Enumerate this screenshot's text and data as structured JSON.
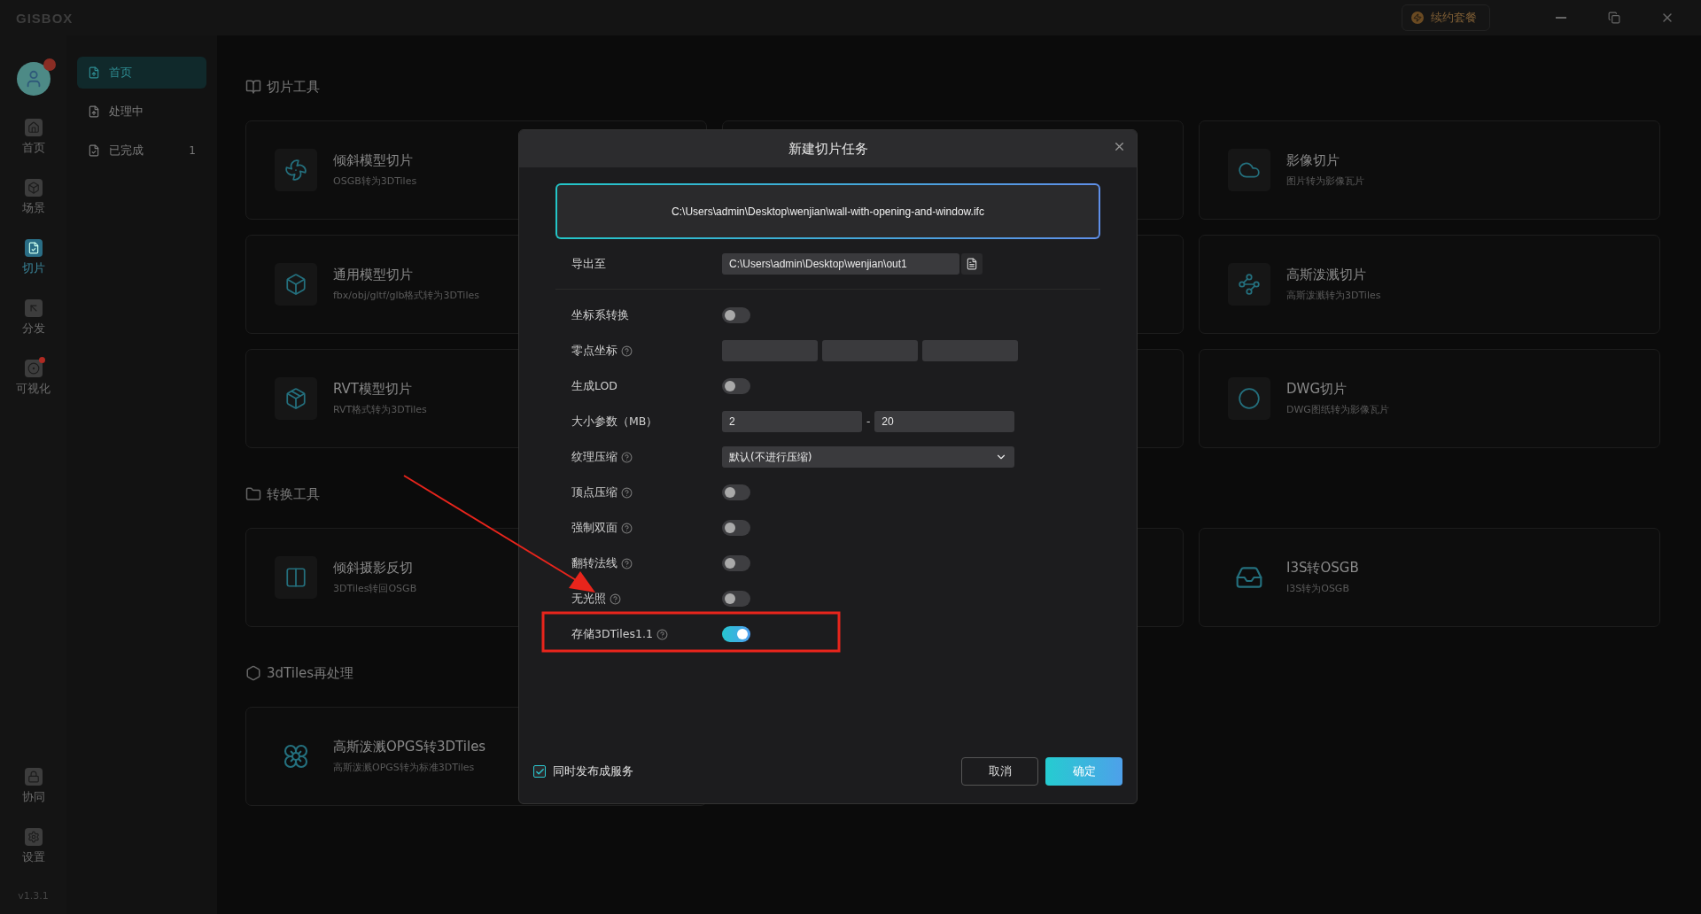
{
  "app": {
    "logo": "GISBOX",
    "renew": "续约套餐",
    "version": "v1.3.1"
  },
  "rail": [
    {
      "label": "首页",
      "selected": false,
      "dot": false
    },
    {
      "label": "场景",
      "selected": false,
      "dot": false
    },
    {
      "label": "切片",
      "selected": true,
      "dot": false
    },
    {
      "label": "分发",
      "selected": false,
      "dot": false
    },
    {
      "label": "可视化",
      "selected": false,
      "dot": true
    }
  ],
  "rail_bottom": [
    {
      "label": "协同"
    },
    {
      "label": "设置"
    }
  ],
  "subnav": [
    {
      "label": "首页",
      "selected": true
    },
    {
      "label": "处理中",
      "selected": false
    },
    {
      "label": "已完成",
      "selected": false,
      "count": "1"
    }
  ],
  "sections": [
    {
      "title": "切片工具",
      "rows": [
        [
          {
            "kind": "card",
            "title": "倾斜模型切片",
            "subtitle": "OSGB转为3DTiles"
          },
          {
            "kind": "covered"
          },
          {
            "kind": "card",
            "title": "影像切片",
            "subtitle": "图片转为影像瓦片"
          }
        ],
        [
          {
            "kind": "card",
            "title": "通用模型切片",
            "subtitle": "fbx/obj/gltf/glb格式转为3DTiles"
          },
          {
            "kind": "covered"
          },
          {
            "kind": "card",
            "title": "高斯泼溅切片",
            "subtitle": "高斯泼溅转为3DTiles"
          }
        ],
        [
          {
            "kind": "card",
            "title": "RVT模型切片",
            "subtitle": "RVT格式转为3DTiles"
          },
          {
            "kind": "covered"
          },
          {
            "kind": "card",
            "title": "DWG切片",
            "subtitle": "DWG图纸转为影像瓦片"
          }
        ]
      ]
    },
    {
      "title": "转换工具",
      "rows": [
        [
          {
            "kind": "card",
            "title": "倾斜摄影反切",
            "subtitle": "3DTiles转回OSGB"
          },
          {
            "kind": "covered"
          },
          {
            "kind": "bare-card",
            "title": "I3S转OSGB",
            "subtitle": "I3S转为OSGB"
          }
        ]
      ]
    },
    {
      "title": "3dTiles再处理",
      "rows": [
        [
          {
            "kind": "bare-card",
            "title": "高斯泼溅OPGS转3DTiles",
            "subtitle": "高斯泼溅OPGS转为标准3DTiles"
          }
        ]
      ]
    }
  ],
  "dialog": {
    "title": "新建切片任务",
    "source_file": "C:\\Users\\admin\\Desktop\\wenjian\\wall-with-opening-and-window.ifc",
    "export": {
      "label": "导出至",
      "value": "C:\\Users\\admin\\Desktop\\wenjian\\out1"
    },
    "settings": [
      {
        "kind": "toggle",
        "label": "坐标系转换",
        "help": false,
        "on": false
      },
      {
        "kind": "triple",
        "label": "零点坐标",
        "help": true
      },
      {
        "kind": "toggle",
        "label": "生成LOD",
        "help": false,
        "on": false
      },
      {
        "kind": "range",
        "label": "大小参数（MB）",
        "help": false,
        "from": "2",
        "separator": "-",
        "to": "20"
      },
      {
        "kind": "select",
        "label": "纹理压缩",
        "help": true,
        "value": "默认(不进行压缩)"
      },
      {
        "kind": "toggle",
        "label": "顶点压缩",
        "help": true,
        "on": false
      },
      {
        "kind": "toggle",
        "label": "强制双面",
        "help": true,
        "on": false
      },
      {
        "kind": "toggle",
        "label": "翻转法线",
        "help": true,
        "on": false
      },
      {
        "kind": "toggle",
        "label": "无光照",
        "help": true,
        "on": false
      },
      {
        "kind": "toggle",
        "label": "存储3DTiles1.1",
        "help": true,
        "on": true
      }
    ],
    "publish": {
      "label": "同时发布成服务",
      "checked": true
    },
    "buttons": [
      {
        "label": "取消",
        "kind": "secondary"
      },
      {
        "label": "确定",
        "kind": "primary"
      }
    ]
  }
}
